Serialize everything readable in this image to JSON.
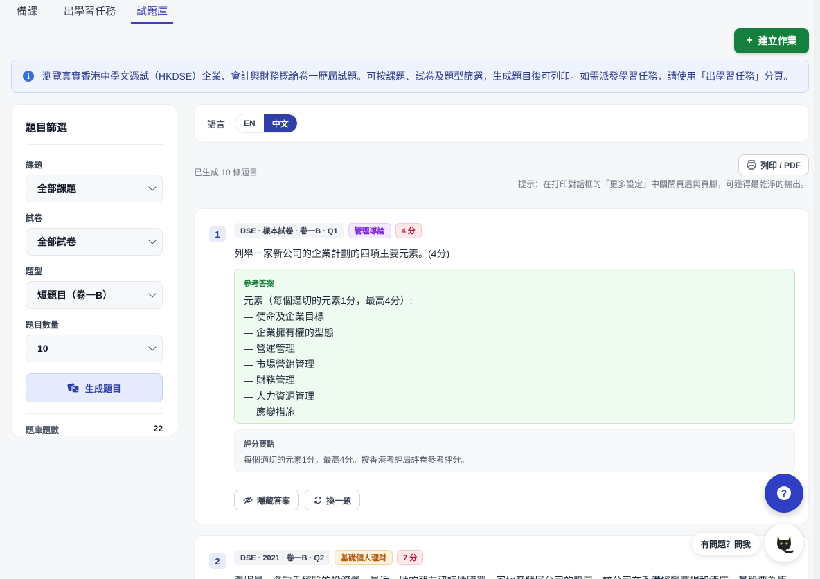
{
  "tabs": [
    {
      "label": "備課"
    },
    {
      "label": "出學習任務"
    },
    {
      "label": "試題庫"
    }
  ],
  "create_button": {
    "icon": "plus-icon",
    "label": "建立作業"
  },
  "info_banner": {
    "text": "瀏覽真實香港中學文憑試（HKDSE）企業、會計與財務概論卷一歷屆試題。可按課題、試卷及題型篩選，生成題目後可列印。如需派發學習任務，請使用「出學習任務」分頁。"
  },
  "sidebar": {
    "title": "題目篩選",
    "topic": {
      "label": "課題",
      "value": "全部課題"
    },
    "paper": {
      "label": "試卷",
      "value": "全部試卷"
    },
    "qtype": {
      "label": "題型",
      "value": "短題目（卷一B）"
    },
    "count": {
      "label": "題目數量",
      "value": "10"
    },
    "generate_label": "生成題目",
    "bank_label": "題庫題數",
    "bank_count": "22"
  },
  "language": {
    "label": "語言",
    "options": [
      "EN",
      "中文"
    ],
    "selected": "中文"
  },
  "results": {
    "count_text": "已生成 10 條題目",
    "print_label": "列印 / PDF",
    "tip": "提示：在打印對話框的「更多設定」中關閉頁眉與頁腳，可獲得最乾淨的輸出。"
  },
  "questions": [
    {
      "number": "1",
      "source": "DSE · 樣本試卷 · 卷一B · Q1",
      "topic": "管理導論",
      "marks": "4 分",
      "text": "列舉一家新公司的企業計劃的四項主要元素。(4分)",
      "answer_title": "參考答案",
      "answer_lines": [
        "元素（每個適切的元素1分，最高4分）:",
        "— 使命及企業目標",
        "— 企業擁有權的型態",
        "— 營運管理",
        "— 市場營銷管理",
        "— 財務管理",
        "— 人力資源管理",
        "— 應變措施"
      ],
      "rubric_title": "評分要點",
      "rubric_text": "每個適切的元素1分，最高4分。按香港考評局評卷參考評分。",
      "hide_label": "隱藏答案",
      "swap_label": "換一題"
    },
    {
      "number": "2",
      "source": "DSE · 2021 · 卷一B · Q2",
      "topic": "基礎個人理財",
      "marks": "7 分",
      "text": "張妮是一名缺乏經驗的投資者。最近，她的朋友建議她購買一家地產發展公司的股票。該公司在香港經營商場和酒店。其股票為恆"
    }
  ],
  "help": {
    "ask_label": "有問題？問我"
  },
  "colors": {
    "accent": "#2f3fa8",
    "create_green": "#15803d",
    "answer_bg": "#effbf1"
  }
}
